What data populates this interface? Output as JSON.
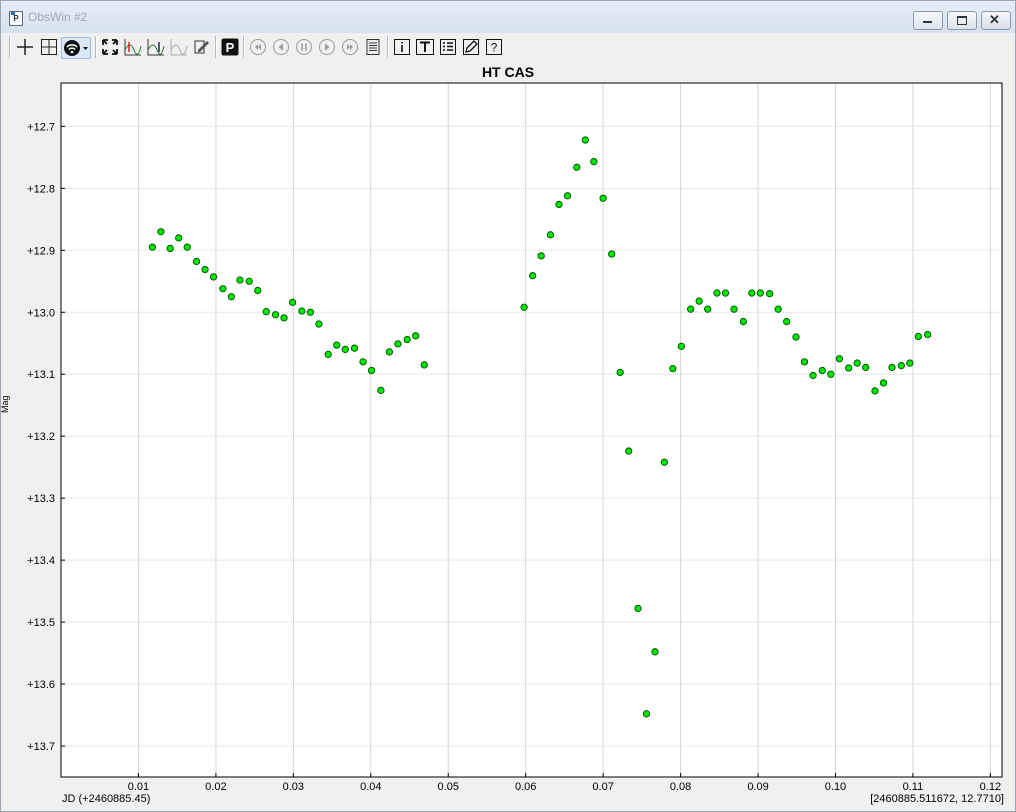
{
  "window": {
    "title": "ObsWin #2"
  },
  "toolbar": {
    "buttons": [
      {
        "name": "crosshair-icon"
      },
      {
        "name": "grid-icon"
      },
      {
        "name": "connection-icon"
      },
      {
        "name": "fit-view-icon"
      },
      {
        "name": "chart-marker-icon"
      },
      {
        "name": "chart-fit-icon"
      },
      {
        "name": "chart-off-icon"
      },
      {
        "name": "edit-marks-icon"
      },
      {
        "name": "p-icon"
      },
      {
        "name": "first-icon"
      },
      {
        "name": "prev-icon"
      },
      {
        "name": "pause-icon"
      },
      {
        "name": "play-icon"
      },
      {
        "name": "last-icon"
      },
      {
        "name": "list-icon"
      },
      {
        "name": "info-icon"
      },
      {
        "name": "text-icon"
      },
      {
        "name": "table-icon"
      },
      {
        "name": "pencil-icon"
      },
      {
        "name": "help-icon"
      }
    ]
  },
  "status": {
    "x_origin_label": "JD (+2460885.45)",
    "cursor_readout": "[2460885.511672, 12.7710]"
  },
  "chart_data": {
    "type": "scatter",
    "title": "HT CAS",
    "xlabel": "JD (+2460885.45)",
    "ylabel": "Mag",
    "xlim": [
      0.0,
      0.1215
    ],
    "ylim": [
      13.75,
      12.63
    ],
    "y_inverted": true,
    "x_ticks": [
      0.01,
      0.02,
      0.03,
      0.04,
      0.05,
      0.06,
      0.07,
      0.08,
      0.09,
      0.1,
      0.11,
      0.12
    ],
    "x_tick_labels": [
      "0.01",
      "0.02",
      "0.03",
      "0.04",
      "0.05",
      "0.06",
      "0.07",
      "0.08",
      "0.09",
      "0.10",
      "0.11",
      "0.12"
    ],
    "y_ticks": [
      12.7,
      12.8,
      12.9,
      13.0,
      13.1,
      13.2,
      13.3,
      13.4,
      13.5,
      13.6,
      13.7
    ],
    "y_tick_labels": [
      "+12.7",
      "+12.8",
      "+12.9",
      "+13.0",
      "+13.1",
      "+13.2",
      "+13.3",
      "+13.4",
      "+13.5",
      "+13.6",
      "+13.7"
    ],
    "grid": true,
    "marker_color": "#00e600",
    "marker_edge": "#005000",
    "points": [
      [
        0.0118,
        12.895
      ],
      [
        0.0129,
        12.87
      ],
      [
        0.0141,
        12.897
      ],
      [
        0.0152,
        12.88
      ],
      [
        0.0163,
        12.895
      ],
      [
        0.0175,
        12.918
      ],
      [
        0.0186,
        12.931
      ],
      [
        0.0197,
        12.943
      ],
      [
        0.0209,
        12.962
      ],
      [
        0.022,
        12.975
      ],
      [
        0.0231,
        12.948
      ],
      [
        0.0243,
        12.95
      ],
      [
        0.0254,
        12.965
      ],
      [
        0.0265,
        12.999
      ],
      [
        0.0277,
        13.004
      ],
      [
        0.0288,
        13.009
      ],
      [
        0.0299,
        12.984
      ],
      [
        0.0311,
        12.998
      ],
      [
        0.0322,
        13.0
      ],
      [
        0.0333,
        13.019
      ],
      [
        0.0345,
        13.068
      ],
      [
        0.0356,
        13.053
      ],
      [
        0.0367,
        13.06
      ],
      [
        0.0379,
        13.058
      ],
      [
        0.039,
        13.08
      ],
      [
        0.0401,
        13.094
      ],
      [
        0.0413,
        13.126
      ],
      [
        0.0424,
        13.064
      ],
      [
        0.0435,
        13.051
      ],
      [
        0.0447,
        13.044
      ],
      [
        0.0458,
        13.038
      ],
      [
        0.0469,
        13.085
      ],
      [
        0.0598,
        12.992
      ],
      [
        0.0609,
        12.941
      ],
      [
        0.062,
        12.909
      ],
      [
        0.0632,
        12.875
      ],
      [
        0.0643,
        12.826
      ],
      [
        0.0654,
        12.812
      ],
      [
        0.0666,
        12.766
      ],
      [
        0.0677,
        12.722
      ],
      [
        0.0688,
        12.757
      ],
      [
        0.07,
        12.816
      ],
      [
        0.0711,
        12.906
      ],
      [
        0.0722,
        13.097
      ],
      [
        0.0733,
        13.224
      ],
      [
        0.0745,
        13.478
      ],
      [
        0.0756,
        13.648
      ],
      [
        0.0767,
        13.548
      ],
      [
        0.0779,
        13.242
      ],
      [
        0.079,
        13.091
      ],
      [
        0.0801,
        13.055
      ],
      [
        0.0813,
        12.995
      ],
      [
        0.0824,
        12.982
      ],
      [
        0.0835,
        12.995
      ],
      [
        0.0847,
        12.969
      ],
      [
        0.0858,
        12.969
      ],
      [
        0.0869,
        12.995
      ],
      [
        0.0881,
        13.015
      ],
      [
        0.0892,
        12.969
      ],
      [
        0.0903,
        12.969
      ],
      [
        0.0915,
        12.97
      ],
      [
        0.0926,
        12.995
      ],
      [
        0.0937,
        13.015
      ],
      [
        0.0949,
        13.04
      ],
      [
        0.096,
        13.08
      ],
      [
        0.0971,
        13.102
      ],
      [
        0.0983,
        13.094
      ],
      [
        0.0994,
        13.1
      ],
      [
        0.1005,
        13.075
      ],
      [
        0.1017,
        13.09
      ],
      [
        0.1028,
        13.082
      ],
      [
        0.1039,
        13.089
      ],
      [
        0.1051,
        13.127
      ],
      [
        0.1062,
        13.114
      ],
      [
        0.1073,
        13.089
      ],
      [
        0.1085,
        13.086
      ],
      [
        0.1096,
        13.082
      ],
      [
        0.1107,
        13.039
      ],
      [
        0.1119,
        13.036
      ]
    ]
  }
}
